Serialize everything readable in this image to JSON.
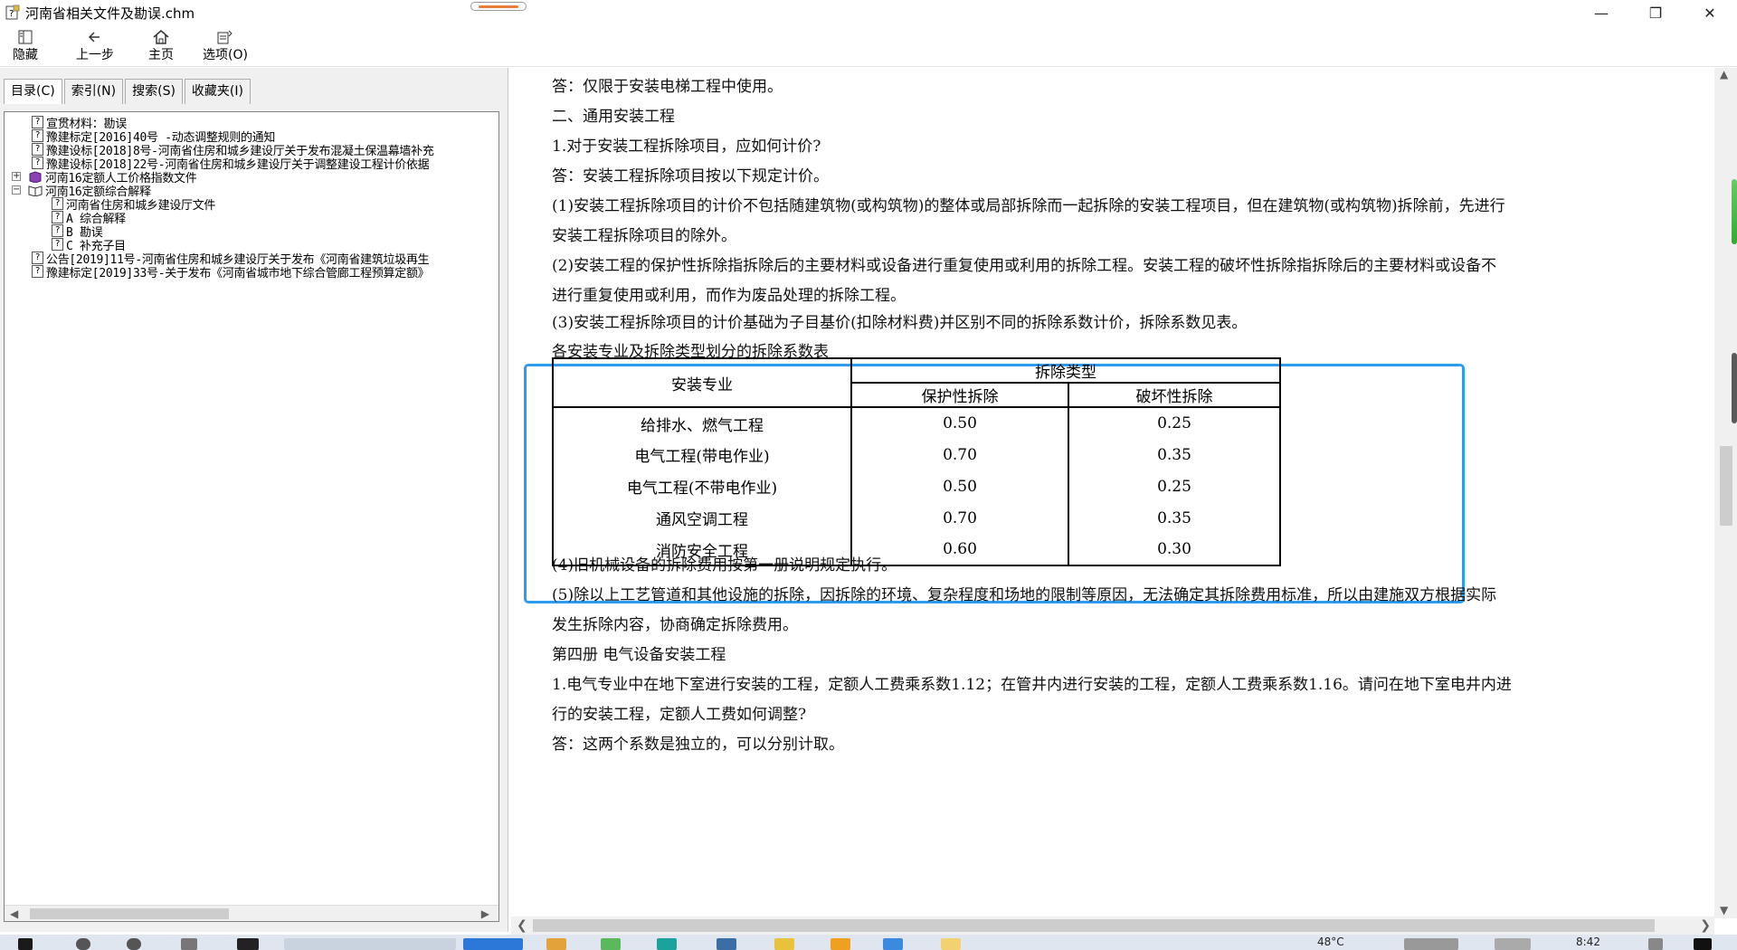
{
  "window": {
    "title": "河南省相关文件及勘误.chm",
    "controls": {
      "minimize": "—",
      "restore": "❐",
      "close": "✕"
    }
  },
  "toolbar": {
    "hide_label": "隐藏",
    "back_label": "上一步",
    "home_label": "主页",
    "options_label": "选项(O)"
  },
  "nav_tabs": [
    {
      "label": "目录(C)"
    },
    {
      "label": "索引(N)"
    },
    {
      "label": "搜索(S)"
    },
    {
      "label": "收藏夹(I)"
    }
  ],
  "tree": [
    {
      "label": "宣贯材料：勘误"
    },
    {
      "label": "豫建标定[2016]40号 -动态调整规则的通知"
    },
    {
      "label": "豫建设标[2018]8号-河南省住房和城乡建设厅关于发布混凝土保温幕墙补充"
    },
    {
      "label": "豫建设标[2018]22号-河南省住房和城乡建设厅关于调整建设工程计价依据"
    },
    {
      "label": "河南16定额人工价格指数文件"
    },
    {
      "label": "河南16定额综合解释"
    },
    {
      "label": "河南省住房和城乡建设厅文件"
    },
    {
      "label": "A 综合解释"
    },
    {
      "label": "B 勘误"
    },
    {
      "label": "C 补充子目"
    },
    {
      "label": "公告[2019]11号-河南省住房和城乡建设厅关于发布《河南省建筑垃圾再生"
    },
    {
      "label": "豫建标定[2019]33号-关于发布《河南省城市地下综合管廊工程预算定额》"
    }
  ],
  "content": {
    "p1": "答：仅限于安装电梯工程中使用。",
    "p2": "二、通用安装工程",
    "p3": "1.对于安装工程拆除项目，应如何计价?",
    "p4": "答：安装工程拆除项目按以下规定计价。",
    "p5a": "(1)安装工程拆除项目的计价不包括随建筑物(或构筑物)的整体或局部拆除而一起拆除的安装工程项目，但在建筑物(或构筑物)拆除前，先进行",
    "p5b": "安装工程拆除项目的除外。",
    "p6a": "(2)安装工程的保护性拆除指拆除后的主要材料或设备进行重复使用或利用的拆除工程。安装工程的破坏性拆除指拆除后的主要材料或设备不",
    "p6b": "进行重复使用或利用，而作为废品处理的拆除工程。",
    "p7": "(3)安装工程拆除项目的计价基础为子目基价(扣除材料费)并区别不同的拆除系数计价，拆除系数见表。",
    "table_caption": "各安装专业及拆除类型划分的拆除系数表",
    "p8": "(4)旧机械设备的拆除费用按第一册说明规定执行。",
    "p9a": "(5)除以上工艺管道和其他设施的拆除，因拆除的环境、复杂程度和场地的限制等原因，无法确定其拆除费用标准，所以由建施双方根据实际",
    "p9b": "发生拆除内容，协商确定拆除费用。",
    "p10": "第四册  电气设备安装工程",
    "p11a": "1.电气专业中在地下室进行安装的工程，定额人工费乘系数1.12；在管井内进行安装的工程，定额人工费乘系数1.16。请问在地下室电井内进",
    "p11b": "行的安装工程，定额人工费如何调整?",
    "p12": "答：这两个系数是独立的，可以分别计取。"
  },
  "coef_table": {
    "col_specialty": "安装专业",
    "col_type": "拆除类型",
    "col_protective": "保护性拆除",
    "col_destructive": "破坏性拆除",
    "rows": [
      {
        "name": "给排水、燃气工程",
        "protective": "0.50",
        "destructive": "0.25"
      },
      {
        "name": "电气工程(带电作业)",
        "protective": "0.70",
        "destructive": "0.35"
      },
      {
        "name": "电气工程(不带电作业)",
        "protective": "0.50",
        "destructive": "0.25"
      },
      {
        "name": "通风空调工程",
        "protective": "0.70",
        "destructive": "0.35"
      },
      {
        "name": "消防安全工程",
        "protective": "0.60",
        "destructive": "0.30"
      }
    ]
  },
  "taskbar": {
    "temperature": "48°C",
    "time": "8:42"
  },
  "colors": {
    "highlight_border": "#2b9bf0",
    "taskbar_bg": "#dfe6ef"
  }
}
